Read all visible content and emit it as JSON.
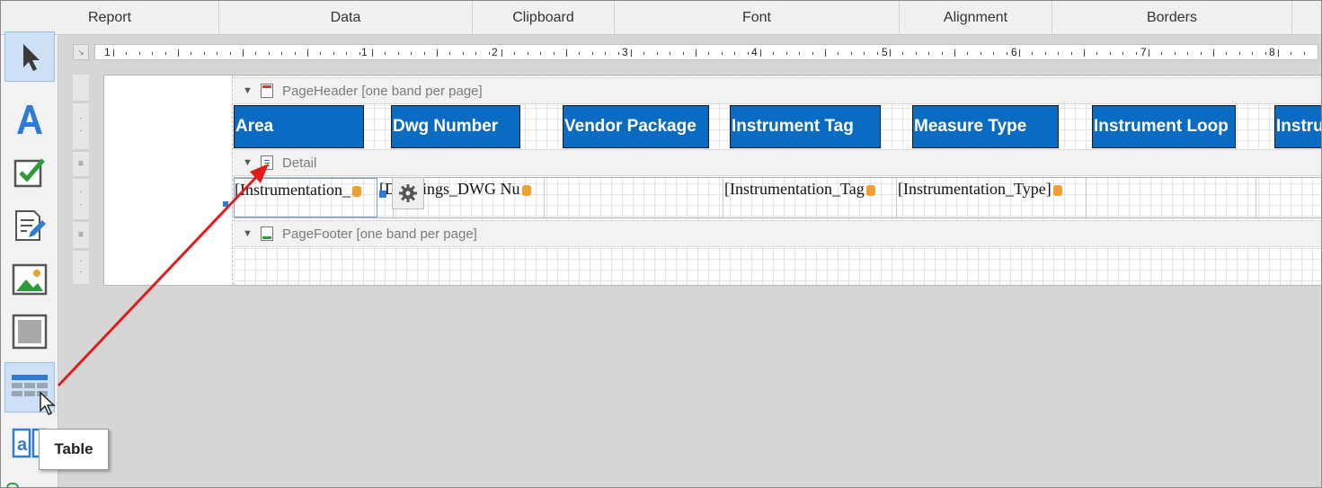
{
  "ribbon": {
    "groups": [
      "Report",
      "Data",
      "Clipboard",
      "Font",
      "Alignment",
      "Borders"
    ]
  },
  "toolbox": {
    "tooltip": "Table",
    "tools": [
      "pointer-icon",
      "label-icon",
      "checkbox-icon",
      "richtext-icon",
      "picture-icon",
      "panel-icon",
      "table-icon",
      "character-comb-icon"
    ]
  },
  "ruler": {
    "numbers": [
      "1",
      "1",
      "2",
      "3",
      "4",
      "5",
      "6",
      "7",
      "8"
    ]
  },
  "bands": {
    "page_header": "PageHeader [one band per page]",
    "detail": "Detail",
    "page_footer": "PageFooter [one band per page]"
  },
  "header_cells": [
    "Area",
    "Dwg Number",
    "Vendor Package",
    "Instrument Tag",
    "Measure Type",
    "Instrument Loop",
    "Instru"
  ],
  "detail_cells": [
    "[Instrumentation_",
    "[D",
    "ings_DWG Nu",
    "",
    "[Instrumentation_Tag",
    "[Instrumentation_Type]",
    "",
    ""
  ],
  "colors": {
    "header_fill": "#0a6bc2",
    "arrow": "#e31b1b",
    "accent": "#2f7bd4"
  }
}
